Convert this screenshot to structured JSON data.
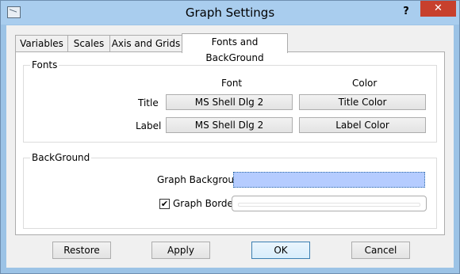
{
  "window": {
    "title": "Graph Settings",
    "help": "?",
    "close": "✕"
  },
  "tabs": [
    "Variables",
    "Scales",
    "Axis and Grids",
    "Fonts and BackGround"
  ],
  "fonts": {
    "group_label": "Fonts",
    "col_font": "Font",
    "col_color": "Color",
    "rows": [
      {
        "label": "Title",
        "font": "MS Shell Dlg 2",
        "color_button": "Title Color"
      },
      {
        "label": "Label",
        "font": "MS Shell Dlg 2",
        "color_button": "Label Color"
      }
    ]
  },
  "background": {
    "group_label": "BackGround",
    "graph_background_label": "Graph Background",
    "graph_background_color": "#b5ccff",
    "graph_border_label": "Graph Border",
    "graph_border_checked": true,
    "check_mark": "✔"
  },
  "buttons": {
    "restore": "Restore",
    "apply": "Apply",
    "ok": "OK",
    "cancel": "Cancel"
  }
}
